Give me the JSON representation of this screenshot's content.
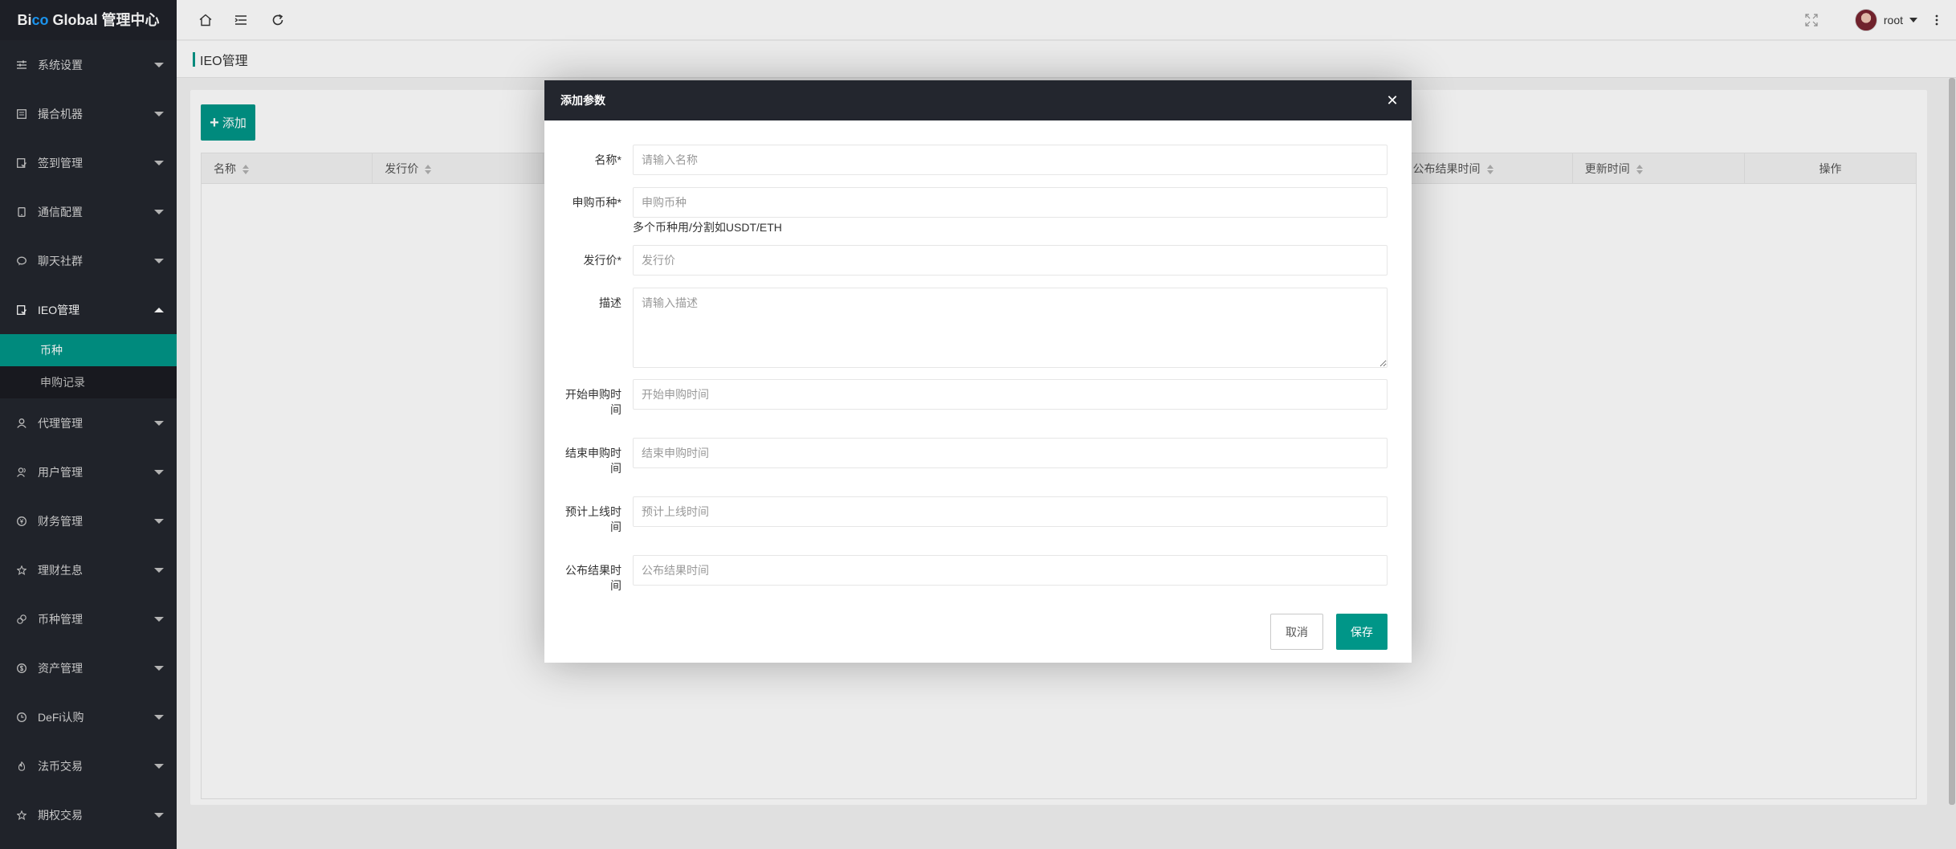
{
  "app": {
    "logo_b": "Bi",
    "logo_co": "co",
    "logo_rest": " Global 管理中心"
  },
  "sidebar": {
    "items": [
      {
        "label": "系统设置",
        "icon": "sliders-icon"
      },
      {
        "label": "撮合机器",
        "icon": "machine-icon"
      },
      {
        "label": "签到管理",
        "icon": "checkin-icon"
      },
      {
        "label": "通信配置",
        "icon": "phone-icon"
      },
      {
        "label": "聊天社群",
        "icon": "chat-icon"
      },
      {
        "label": "IEO管理",
        "icon": "ieo-icon",
        "open": true,
        "children": [
          {
            "label": "币种",
            "active": true
          },
          {
            "label": "申购记录",
            "active": false
          }
        ]
      },
      {
        "label": "代理管理",
        "icon": "user-icon"
      },
      {
        "label": "用户管理",
        "icon": "users-icon"
      },
      {
        "label": "财务管理",
        "icon": "yen-icon"
      },
      {
        "label": "理财生息",
        "icon": "star-icon"
      },
      {
        "label": "币种管理",
        "icon": "coins-icon"
      },
      {
        "label": "资产管理",
        "icon": "dollar-icon"
      },
      {
        "label": "DeFi认购",
        "icon": "clock-icon"
      },
      {
        "label": "法币交易",
        "icon": "fire-icon"
      },
      {
        "label": "期权交易",
        "icon": "star-icon"
      }
    ]
  },
  "header": {
    "username": "root"
  },
  "page": {
    "title": "IEO管理",
    "add_button": "添加"
  },
  "table": {
    "columns": [
      "名称",
      "发行价",
      "",
      "",
      "",
      "",
      "",
      "公布结果时间",
      "更新时间",
      "操作"
    ]
  },
  "modal": {
    "title": "添加参数",
    "fields": {
      "name": {
        "label": "名称*",
        "placeholder": "请输入名称"
      },
      "coin": {
        "label": "申购币种*",
        "placeholder": "申购币种",
        "hint": "多个币种用/分割如USDT/ETH"
      },
      "price": {
        "label": "发行价*",
        "placeholder": "发行价"
      },
      "desc": {
        "label": "描述",
        "placeholder": "请输入描述"
      },
      "start_time": {
        "label_1": "开始申购时",
        "label_2": "间",
        "placeholder": "开始申购时间"
      },
      "end_time": {
        "label_1": "结束申购时",
        "label_2": "间",
        "placeholder": "结束申购时间"
      },
      "launch_time": {
        "label_1": "预计上线时",
        "label_2": "间",
        "placeholder": "预计上线时间"
      },
      "result_time": {
        "label_1": "公布结果时",
        "label_2": "间",
        "placeholder": "公布结果时间"
      }
    },
    "cancel": "取消",
    "save": "保存"
  },
  "colors": {
    "accent": "#009688",
    "sidebar_bg": "#23262e",
    "modal_header_bg": "#23262e"
  }
}
